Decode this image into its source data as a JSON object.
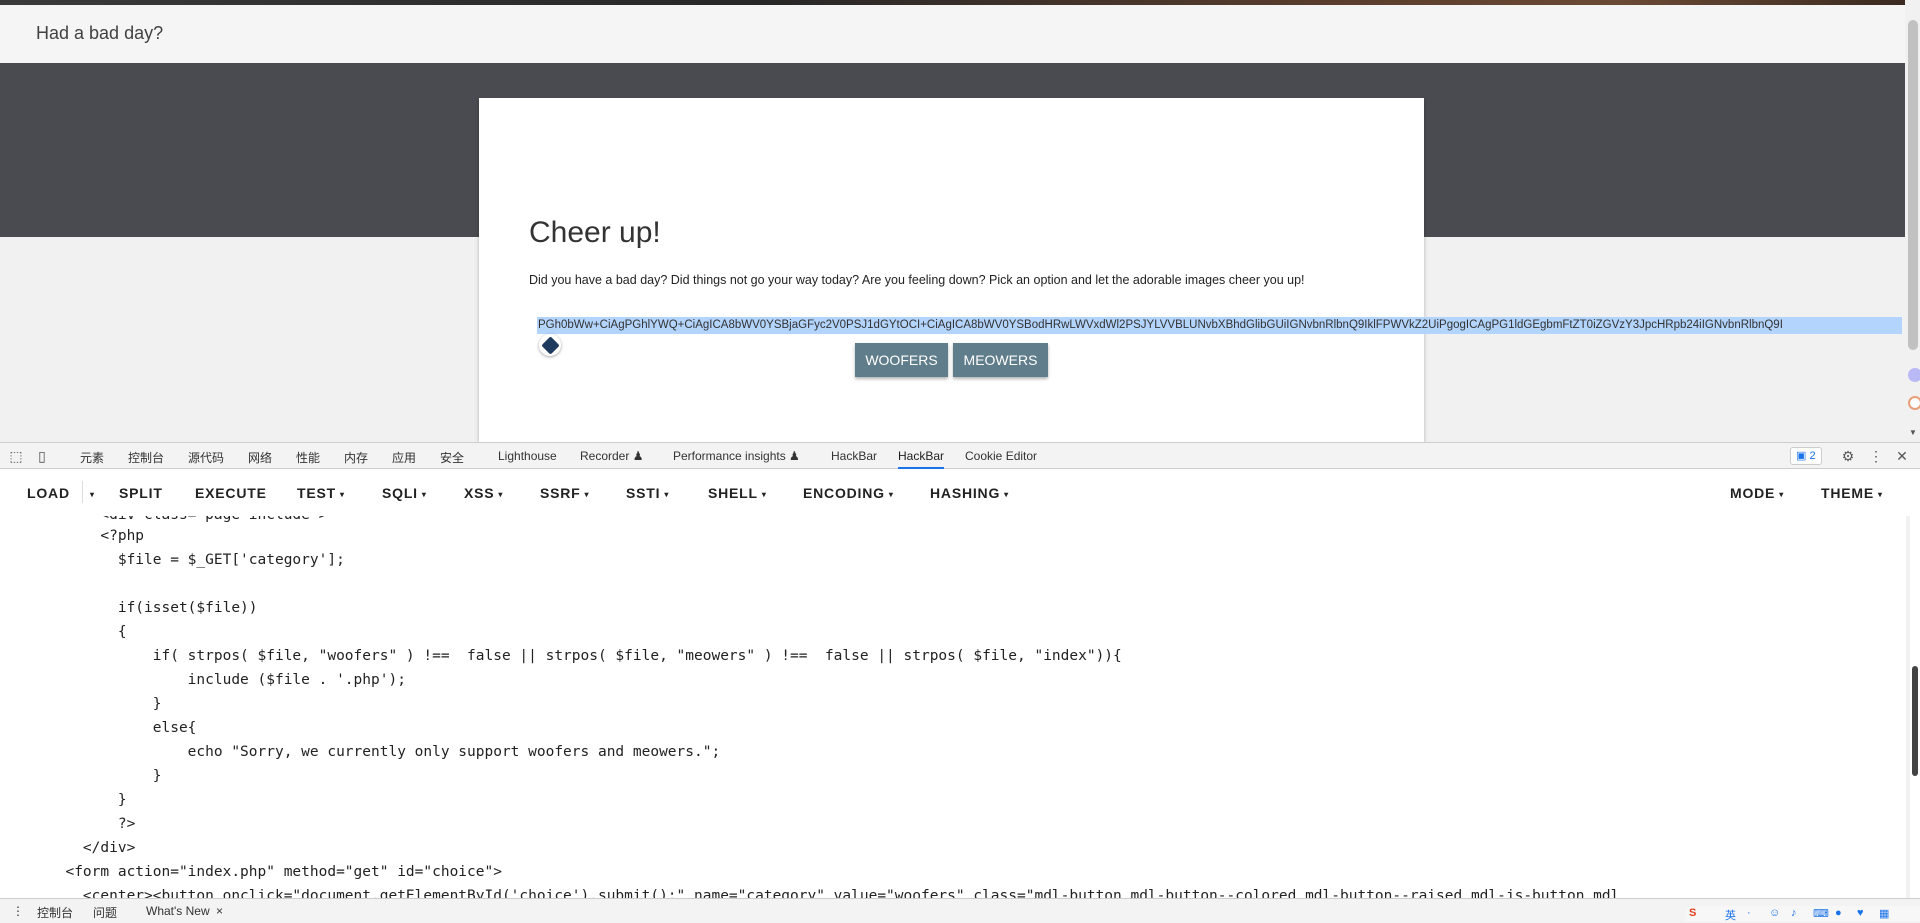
{
  "site": {
    "header_title": "Had a bad day?",
    "card_title": "Cheer up!",
    "card_description": "Did you have a bad day? Did things not go your way today? Are you feeling down? Pick an option and let the adorable images cheer you up!",
    "selected_text": "PGh0bWw+CiAgPGhlYWQ+CiAgICA8bWV0YSBjaGFyc2V0PSJ1dGYtOCI+CiAgICA8bWV0YSBodHRwLWVxdWl2PSJYLVVBLUNvbXBhdGlibGUiIGNvbnRlbnQ9IklFPWVkZ2UiPgogICAgPG1ldGEgbmFtZT0iZGVzY3JpcHRpb24iIGNvbnRlbnQ9I",
    "buttons": [
      {
        "label": "WOOFERS"
      },
      {
        "label": "MEOWERS"
      }
    ]
  },
  "devtools": {
    "tabs": [
      "元素",
      "控制台",
      "源代码",
      "网络",
      "性能",
      "内存",
      "应用",
      "安全",
      "Lighthouse",
      "Recorder ♟",
      "Performance insights ♟",
      "HackBar",
      "HackBar",
      "Cookie Editor"
    ],
    "active_tab": "HackBar",
    "issues_badge": "2",
    "drawer_tabs": [
      "控制台",
      "问题",
      "What's New"
    ],
    "drawer_close": "×"
  },
  "hackbar": {
    "buttons": [
      "LOAD",
      "SPLIT",
      "EXECUTE",
      "TEST",
      "SQLI",
      "XSS",
      "SSRF",
      "SSTI",
      "SHELL",
      "ENCODING",
      "HASHING"
    ],
    "right_buttons": [
      "MODE",
      "THEME"
    ],
    "dropdown_caret": "▾"
  },
  "code_lines": [
    "      <div class=\"page-include\">",
    "      <?php",
    "        $file = $_GET['category'];",
    "",
    "        if(isset($file))",
    "        {",
    "            if( strpos( $file, \"woofers\" ) !==  false || strpos( $file, \"meowers\" ) !==  false || strpos( $file, \"index\")){",
    "                include ($file . '.php');",
    "            }",
    "            else{",
    "                echo \"Sorry, we currently only support woofers and meowers.\";",
    "            }",
    "        }",
    "        ?>",
    "    </div>",
    "  <form action=\"index.php\" method=\"get\" id=\"choice\">",
    "    <center><button onclick=\"document.getElementById('choice').submit();\" name=\"category\" value=\"woofers\" class=\"mdl-button mdl-button--colored mdl-button--raised mdl-js-button mdl"
  ],
  "colors": {
    "dark_band": "#4a4b50",
    "button": "#607d8b",
    "selection": "#b3d4fc",
    "devtools_accent": "#1a73e8"
  }
}
